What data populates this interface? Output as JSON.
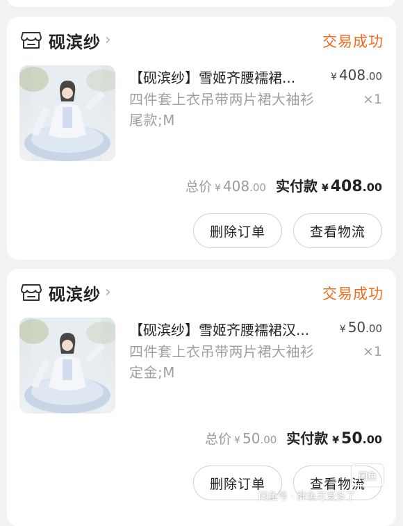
{
  "orders": [
    {
      "shop_name": "砚滨纱",
      "status": "交易成功",
      "item_title": "【砚滨纱】雪姬齐腰襦裙...",
      "price_symbol": "¥",
      "price_int": "408",
      "price_dec": ".00",
      "spec": "四件套上衣吊带两片裙大袖衫尾款;M",
      "quantity": "×1",
      "total_label": "总价",
      "total_symbol": "¥",
      "total_int": "408",
      "total_dec": ".00",
      "paid_label": "实付款",
      "paid_symbol": "¥",
      "paid_int": "408",
      "paid_dec": ".00",
      "delete_label": "删除订单",
      "logistics_label": "查看物流"
    },
    {
      "shop_name": "砚滨纱",
      "status": "交易成功",
      "item_title": "【砚滨纱】雪姬齐腰襦裙汉...",
      "price_symbol": "¥",
      "price_int": "50",
      "price_dec": ".00",
      "spec": "四件套上衣吊带两片裙大袖衫定金;M",
      "quantity": "×1",
      "total_label": "总价",
      "total_symbol": "¥",
      "total_int": "50",
      "total_dec": ".00",
      "paid_label": "实付款",
      "paid_symbol": "¥",
      "paid_int": "50",
      "paid_dec": ".00",
      "delete_label": "删除订单",
      "logistics_label": "查看物流"
    }
  ],
  "watermark": {
    "text": "闲鱼号 · 胖鱼可爱多了",
    "logo_text": "闲鱼"
  },
  "colors": {
    "status": "#f06a1c",
    "background": "#f2f2f2",
    "card": "#ffffff"
  },
  "icons": {
    "shop": "shop-icon",
    "chevron": "chevron-right-icon"
  }
}
